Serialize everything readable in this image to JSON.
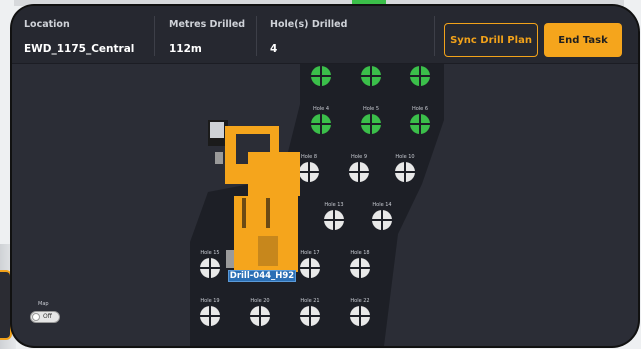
{
  "header": {
    "location_label": "Location",
    "location_value": "EWD_1175_Central",
    "metres_label": "Metres Drilled",
    "metres_value": "112m",
    "holes_label": "Hole(s) Drilled",
    "holes_value": "4"
  },
  "actions": {
    "sync_label": "Sync Drill Plan",
    "end_label": "End Task"
  },
  "map": {
    "rig_label": "Drill-044_H92",
    "toggle_label": "Map",
    "toggle_state": "Off",
    "drilled_color": "#3bbf4a",
    "undrilled_color": "#e8e8e8",
    "rig_color": "#f5a51c",
    "holes": [
      {
        "label": "",
        "status": "drilled"
      },
      {
        "label": "",
        "status": "drilled"
      },
      {
        "label": "",
        "status": "drilled"
      },
      {
        "label": "Hole 4",
        "status": "drilled"
      },
      {
        "label": "Hole 5",
        "status": "drilled"
      },
      {
        "label": "Hole 6",
        "status": "drilled"
      },
      {
        "label": "Hole 7",
        "status": "drilled"
      },
      {
        "label": "Hole 8",
        "status": "planned"
      },
      {
        "label": "Hole 9",
        "status": "planned"
      },
      {
        "label": "Hole 10",
        "status": "planned"
      },
      {
        "label": "Hole 13",
        "status": "planned"
      },
      {
        "label": "Hole 14",
        "status": "planned"
      },
      {
        "label": "Hole 15",
        "status": "planned"
      },
      {
        "label": "Hole 17",
        "status": "planned"
      },
      {
        "label": "Hole 18",
        "status": "planned"
      },
      {
        "label": "Hole 19",
        "status": "planned"
      },
      {
        "label": "Hole 20",
        "status": "planned"
      },
      {
        "label": "Hole 21",
        "status": "planned"
      },
      {
        "label": "Hole 22",
        "status": "planned"
      }
    ]
  }
}
